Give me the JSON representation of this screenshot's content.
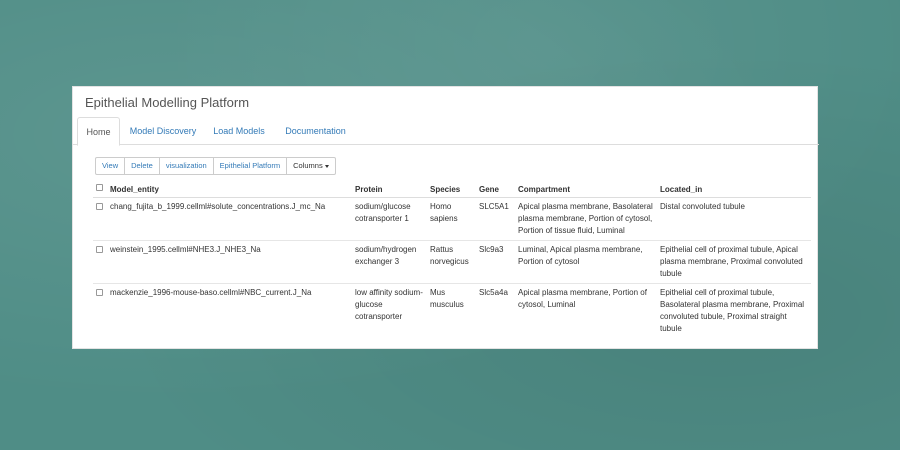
{
  "app": {
    "title": "Epithelial Modelling Platform"
  },
  "nav": {
    "tabs": [
      {
        "label": "Home",
        "active": true
      },
      {
        "label": "Model Discovery",
        "active": false
      },
      {
        "label": "Load Models",
        "active": false
      },
      {
        "label": "Documentation",
        "active": false
      }
    ]
  },
  "toolbar": {
    "view_label": "View",
    "delete_label": "Delete",
    "visualization_label": "visualization",
    "epithelial_label": "Epithelial Platform",
    "columns_label": "Columns"
  },
  "table": {
    "headers": [
      "Model_entity",
      "Protein",
      "Species",
      "Gene",
      "Compartment",
      "Located_in"
    ],
    "rows": [
      {
        "model_entity": "chang_fujita_b_1999.cellml#solute_concentrations.J_mc_Na",
        "protein": "sodium/glucose cotransporter 1",
        "species": "Homo sapiens",
        "gene": "SLC5A1",
        "compartment": "Apical plasma membrane, Basolateral plasma membrane, Portion of cytosol, Portion of tissue fluid, Luminal",
        "located_in": "Distal convoluted tubule"
      },
      {
        "model_entity": "weinstein_1995.cellml#NHE3.J_NHE3_Na",
        "protein": "sodium/hydrogen exchanger 3",
        "species": "Rattus norvegicus",
        "gene": "Slc9a3",
        "compartment": "Luminal, Apical plasma membrane, Portion of cytosol",
        "located_in": "Epithelial cell of proximal tubule, Apical plasma membrane, Proximal convoluted tubule"
      },
      {
        "model_entity": "mackenzie_1996-mouse-baso.cellml#NBC_current.J_Na",
        "protein": "low affinity sodium-glucose cotransporter",
        "species": "Mus musculus",
        "gene": "Slc5a4a",
        "compartment": "Apical plasma membrane, Portion of cytosol, Luminal",
        "located_in": "Epithelial cell of proximal tubule, Basolateral plasma membrane, Proximal convoluted tubule, Proximal straight tubule"
      }
    ]
  },
  "colors": {
    "background": "#4f8d86",
    "link": "#337ab7",
    "text": "#333333"
  }
}
